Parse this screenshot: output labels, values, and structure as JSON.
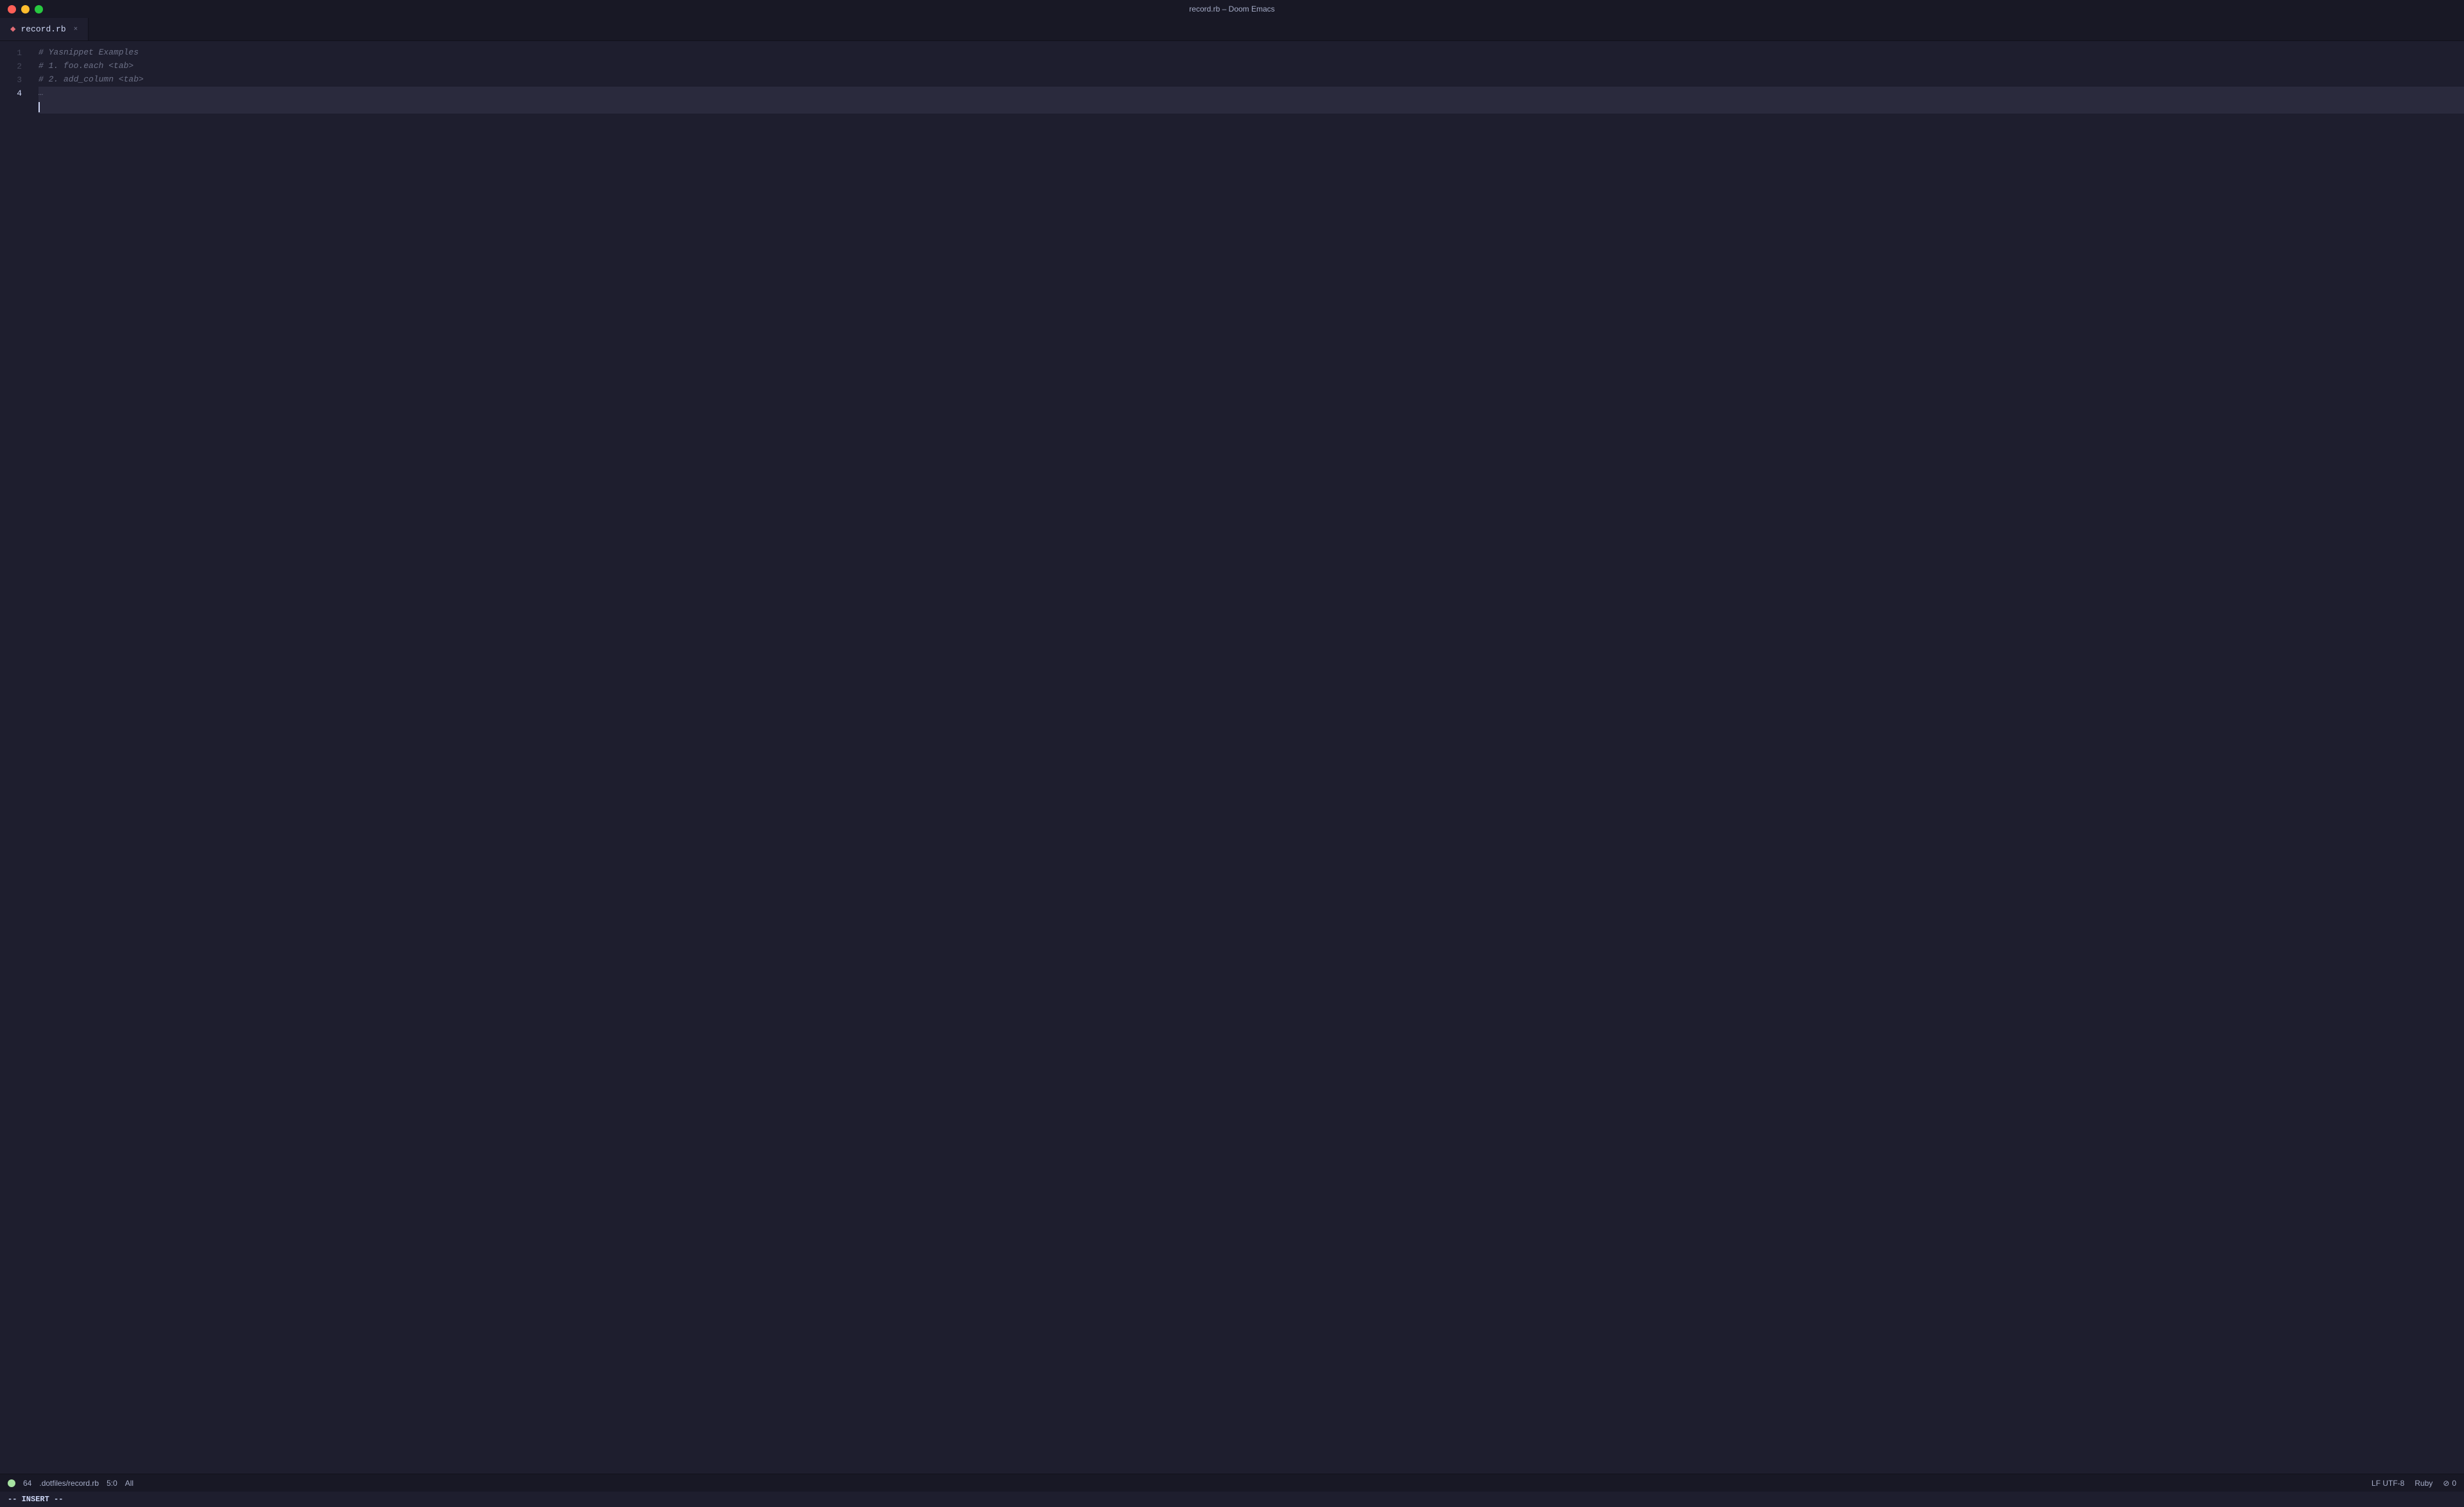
{
  "window": {
    "title": "record.rb – Doom Emacs"
  },
  "traffic_lights": {
    "close_label": "close",
    "minimize_label": "minimize",
    "maximize_label": "maximize"
  },
  "tab": {
    "icon": "◆",
    "name": "record.rb",
    "close_symbol": "×",
    "modified": false
  },
  "editor": {
    "lines": [
      {
        "num": "1",
        "content": "# Yasnippet Examples",
        "is_comment": true,
        "is_current": false
      },
      {
        "num": "2",
        "content": "# 1. foo.each <tab>",
        "is_comment": true,
        "is_current": false
      },
      {
        "num": "3",
        "content": "# 2. add_column <tab>",
        "is_comment": true,
        "is_current": false
      },
      {
        "num": "4",
        "content": "…",
        "is_comment": false,
        "is_current": true
      }
    ]
  },
  "status_bar": {
    "indicator_color": "#a6e3a1",
    "lsp_number": "64",
    "file_path": ".dotfiles/record.rb",
    "position": "5:0",
    "scope": "All",
    "encoding": "LF UTF-8",
    "language": "Ruby",
    "warning_icon": "⊘",
    "warning_count": "0"
  },
  "mode_bar": {
    "mode": "-- INSERT --"
  }
}
